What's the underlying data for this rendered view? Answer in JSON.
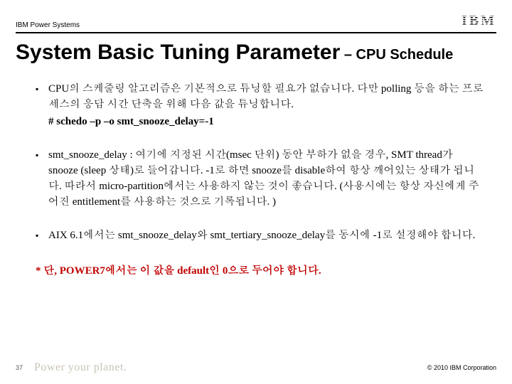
{
  "header": {
    "product_line": "IBM Power Systems",
    "logo_text": "IBM"
  },
  "title": {
    "main": "System Basic Tuning Parameter",
    "sub": " – CPU Schedule"
  },
  "bullets": [
    {
      "text": "CPU의 스케줄링 알고리즘은 기본적으로 튜닝할 필요가 없습니다.  다만 polling 등을 하는 프로세스의 응답 시간 단축을 위해 다음 값을 튜닝합니다.",
      "command": "# schedo –p –o smt_snooze_delay=-1"
    },
    {
      "text": "smt_snooze_delay : 여기에 지정된 시간(msec 단위) 동안 부하가 없을 경우, SMT thread가 snooze (sleep 상태)로 들어갑니다.  -1로 하면 snooze를 disable하여 항상 깨어있는 상태가 됩니다.  따라서 micro-partition에서는 사용하지 않는 것이 좋습니다. (사용시에는 항상 자신에게 주어진 entitlement를 사용하는 것으로 기록됩니다. )"
    },
    {
      "text": "AIX 6.1에서는 smt_snooze_delay와 smt_tertiary_snooze_delay를 동시에 -1로 설정해야 합니다."
    }
  ],
  "warning": "* 단, POWER7에서는 이 값을 default인 0으로 두어야 합니다.",
  "footer": {
    "page": "37",
    "tagline": "Power your planet.",
    "copyright": "© 2010 IBM Corporation"
  }
}
